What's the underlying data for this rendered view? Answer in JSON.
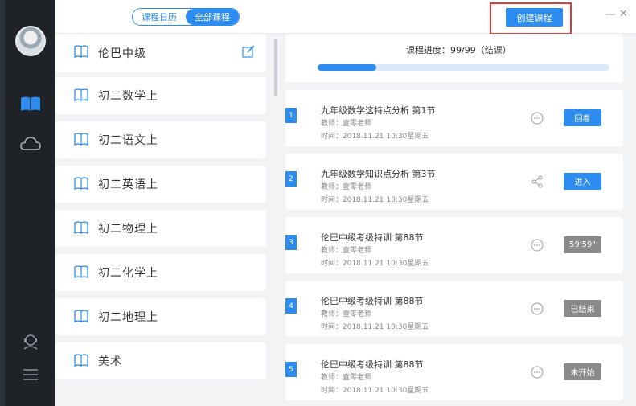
{
  "header": {
    "tabs": [
      {
        "label": "课程日历"
      },
      {
        "label": "全部课程",
        "active": true
      }
    ],
    "create_button": "创建课程",
    "minimize": "—",
    "close": "✕"
  },
  "sidebar": {
    "icons": [
      "avatar",
      "course-book-icon",
      "cloud-icon",
      "service-icon",
      "menu-icon"
    ]
  },
  "courses": [
    {
      "label": "伦巴中级"
    },
    {
      "label": "初二数学上"
    },
    {
      "label": "初二语文上"
    },
    {
      "label": "初二英语上"
    },
    {
      "label": "初二物理上"
    },
    {
      "label": "初二化学上"
    },
    {
      "label": "初二地理上"
    },
    {
      "label": "美术"
    }
  ],
  "progress": {
    "label": "课程进度：99/99（结课）",
    "value": 0.2
  },
  "lessons": [
    {
      "num": "1",
      "title": "九年级数学这特点分析 第1节",
      "teacher": "教师：壹零老师",
      "time": "时间：2018.11.21 10:30星期五",
      "icon": "more-icon",
      "action": "回看",
      "action_style": "blue"
    },
    {
      "num": "2",
      "title": "九年级数学知识点分析 第3节",
      "teacher": "教师：壹零老师",
      "time": "时间：2018.11.21 10:30星期五",
      "icon": "share-icon",
      "action": "进入",
      "action_style": "blue"
    },
    {
      "num": "3",
      "title": "伦巴中级考级特训 第88节",
      "teacher": "教师：壹零老师",
      "time": "时间：2018.11.21 10:30星期五",
      "icon": "more-icon",
      "action": "59'59\"",
      "action_style": "gray"
    },
    {
      "num": "4",
      "title": "伦巴中级考级特训 第88节",
      "teacher": "教师：壹零老师",
      "time": "时间：2018.11.21 10:30星期五",
      "icon": "more-icon",
      "action": "已结束",
      "action_style": "gray"
    },
    {
      "num": "5",
      "title": "伦巴中级考级特训 第88节",
      "teacher": "教师：壹零老师",
      "time": "时间：2018.11.21 10:30星期五",
      "icon": "more-icon",
      "action": "未开始",
      "action_style": "gray"
    }
  ],
  "colors": {
    "accent": "#2d8cf0",
    "rail": "#1f2328",
    "highlight": "#e53935",
    "muted_button": "#8a8a8a"
  }
}
